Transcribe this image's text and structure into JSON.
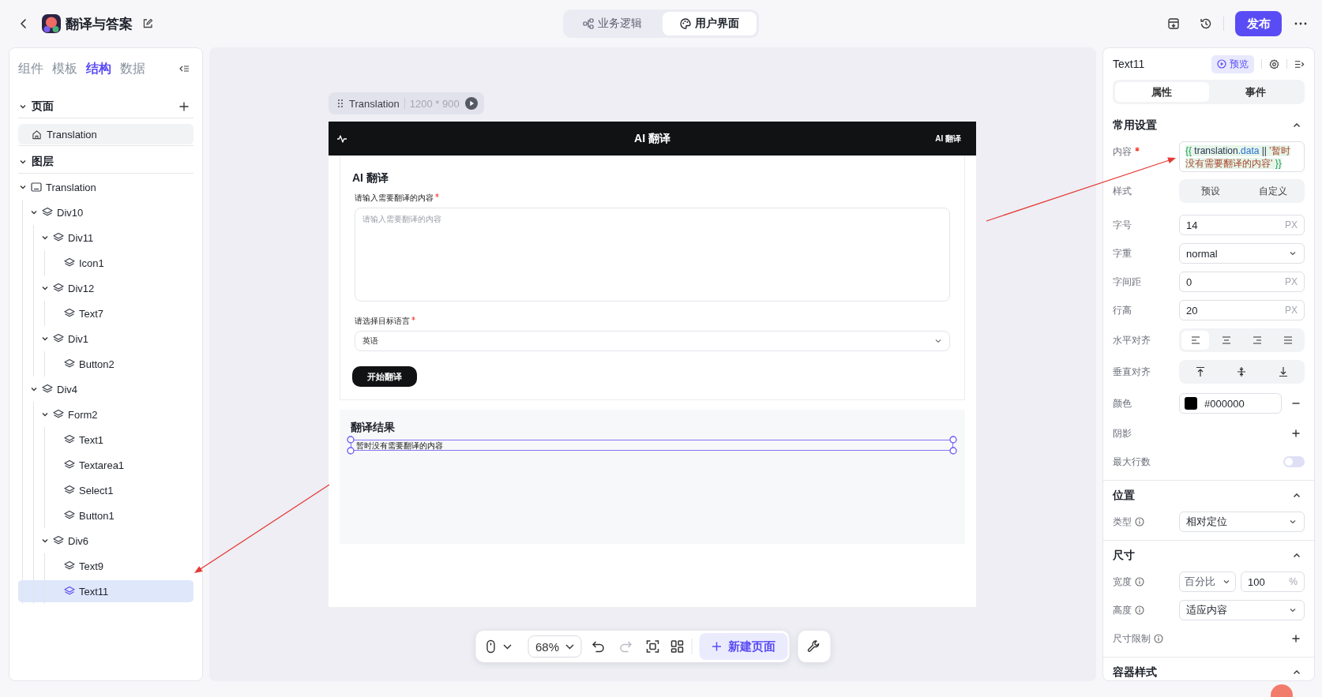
{
  "app_bar": {
    "title": "翻译与答案",
    "modes": [
      {
        "label": "业务逻辑",
        "selected": false
      },
      {
        "label": "用户界面",
        "selected": true
      }
    ],
    "publish": "发布"
  },
  "left_panel": {
    "tabs": [
      {
        "label": "组件",
        "selected": false
      },
      {
        "label": "模板",
        "selected": false
      },
      {
        "label": "结构",
        "selected": true
      },
      {
        "label": "数据",
        "selected": false
      }
    ],
    "pages": {
      "title": "页面",
      "expanded": true,
      "items": [
        {
          "label": "Translation",
          "selected": true
        }
      ]
    },
    "layers": {
      "title": "图层",
      "expanded": true,
      "tree": [
        {
          "label": "Translation",
          "kind": "page",
          "expanded": true,
          "selected": false,
          "children": [
            {
              "label": "Div10",
              "kind": "layer",
              "expanded": true,
              "selected": false,
              "children": [
                {
                  "label": "Div11",
                  "kind": "layer",
                  "expanded": true,
                  "selected": false,
                  "children": [
                    {
                      "label": "Icon1",
                      "kind": "layer",
                      "selected": false
                    }
                  ]
                },
                {
                  "label": "Div12",
                  "kind": "layer",
                  "expanded": true,
                  "selected": false,
                  "children": [
                    {
                      "label": "Text7",
                      "kind": "layer",
                      "selected": false
                    }
                  ]
                },
                {
                  "label": "Div1",
                  "kind": "layer",
                  "expanded": true,
                  "selected": false,
                  "children": [
                    {
                      "label": "Button2",
                      "kind": "layer",
                      "selected": false
                    }
                  ]
                }
              ]
            },
            {
              "label": "Div4",
              "kind": "layer",
              "expanded": true,
              "selected": false,
              "children": [
                {
                  "label": "Form2",
                  "kind": "layer",
                  "expanded": true,
                  "selected": false,
                  "children": [
                    {
                      "label": "Text1",
                      "kind": "layer",
                      "selected": false
                    },
                    {
                      "label": "Textarea1",
                      "kind": "layer",
                      "selected": false
                    },
                    {
                      "label": "Select1",
                      "kind": "layer",
                      "selected": false
                    },
                    {
                      "label": "Button1",
                      "kind": "layer",
                      "selected": false
                    }
                  ]
                },
                {
                  "label": "Div6",
                  "kind": "layer",
                  "expanded": true,
                  "selected": false,
                  "children": [
                    {
                      "label": "Text9",
                      "kind": "layer",
                      "selected": false
                    },
                    {
                      "label": "Text11",
                      "kind": "layer",
                      "selected": true
                    }
                  ]
                }
              ]
            }
          ]
        }
      ]
    }
  },
  "canvas": {
    "page_tag": {
      "name": "Translation",
      "size": "1200 * 900"
    },
    "preview": {
      "header": {
        "title": "AI 翻译",
        "nav_text": "AI 翻译"
      },
      "form": {
        "title": "AI 翻译",
        "fields": [
          {
            "kind": "textarea",
            "label": "请输入需要翻译的内容",
            "required": true,
            "placeholder": "请输入需要翻译的内容"
          },
          {
            "kind": "select",
            "label": "请选择目标语言",
            "required": true,
            "value": "英语"
          }
        ],
        "submit": "开始翻译"
      },
      "result": {
        "title": "翻译结果",
        "text": "暂时没有需要翻译的内容",
        "selected": true
      }
    },
    "toolbar": {
      "zoom": "68%",
      "undo": {
        "disabled": false
      },
      "redo": {
        "disabled": true
      },
      "new_page": "新建页面"
    }
  },
  "inspector": {
    "component": "Text11",
    "preview": "预览",
    "tabs": [
      {
        "label": "属性",
        "selected": true
      },
      {
        "label": "事件",
        "selected": false
      }
    ],
    "sections": [
      {
        "title": "常用设置",
        "expanded": true,
        "rows": [
          {
            "kind": "code",
            "label": "内容",
            "required": true,
            "tokens": [
              {
                "text": "{{",
                "kind": "brace"
              },
              {
                "text": " translation",
                "kind": "identifier"
              },
              {
                "text": ".data",
                "kind": "property"
              },
              {
                "text": " || ",
                "kind": "operator"
              },
              {
                "text": "'暂时没有需要翻译的内容'",
                "kind": "string"
              },
              {
                "text": " }}",
                "kind": "brace"
              }
            ]
          },
          {
            "kind": "segmented",
            "label": "样式",
            "options": [
              {
                "label": "预设",
                "selected": false
              },
              {
                "label": "自定义",
                "selected": false
              }
            ]
          },
          {
            "kind": "number",
            "label": "字号",
            "value": "14",
            "unit": "PX"
          },
          {
            "kind": "select",
            "label": "字重",
            "value": "normal"
          },
          {
            "kind": "number",
            "label": "字间距",
            "value": "0",
            "unit": "PX"
          },
          {
            "kind": "number",
            "label": "行高",
            "value": "20",
            "unit": "PX"
          },
          {
            "kind": "halign",
            "label": "水平对齐",
            "options": [
              {
                "selected": true
              },
              {
                "selected": false
              },
              {
                "selected": false
              },
              {
                "selected": false
              }
            ]
          },
          {
            "kind": "valign",
            "label": "垂直对齐",
            "options": [
              {
                "selected": false
              },
              {
                "selected": false
              },
              {
                "selected": false
              }
            ]
          },
          {
            "kind": "color",
            "label": "颜色",
            "value": "#000000",
            "color": "#000000"
          },
          {
            "kind": "add",
            "label": "阴影"
          },
          {
            "kind": "toggle",
            "label": "最大行数",
            "on": false
          }
        ]
      },
      {
        "title": "位置",
        "expanded": true,
        "rows": [
          {
            "kind": "select",
            "label": "类型",
            "info": true,
            "value": "相对定位"
          }
        ]
      },
      {
        "title": "尺寸",
        "expanded": true,
        "rows": [
          {
            "kind": "unit_select",
            "label": "宽度",
            "info": true,
            "mode": "百分比",
            "value": "100",
            "unit": "%"
          },
          {
            "kind": "select",
            "label": "高度",
            "info": true,
            "value": "适应内容"
          },
          {
            "kind": "add",
            "label": "尺寸限制",
            "info": true
          }
        ]
      },
      {
        "title": "容器样式",
        "expanded": true
      }
    ]
  }
}
